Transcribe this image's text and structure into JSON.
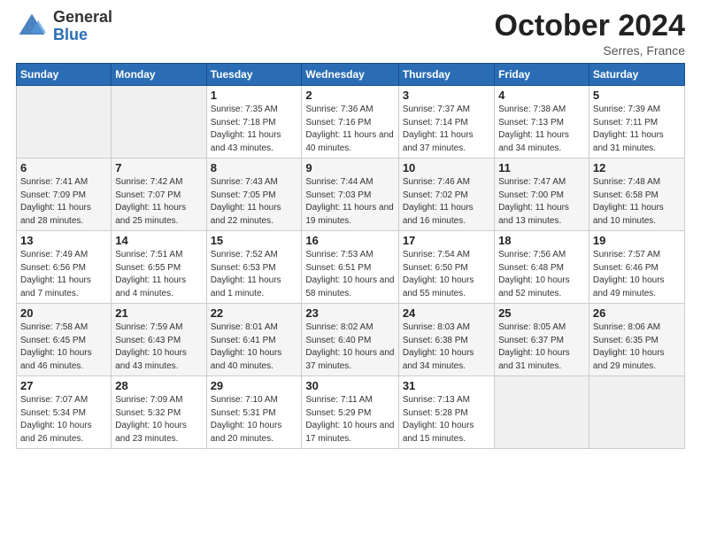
{
  "logo": {
    "general": "General",
    "blue": "Blue"
  },
  "header": {
    "month": "October 2024",
    "location": "Serres, France"
  },
  "days_of_week": [
    "Sunday",
    "Monday",
    "Tuesday",
    "Wednesday",
    "Thursday",
    "Friday",
    "Saturday"
  ],
  "weeks": [
    [
      {
        "day": "",
        "sunrise": "",
        "sunset": "",
        "daylight": ""
      },
      {
        "day": "",
        "sunrise": "",
        "sunset": "",
        "daylight": ""
      },
      {
        "day": "1",
        "sunrise": "Sunrise: 7:35 AM",
        "sunset": "Sunset: 7:18 PM",
        "daylight": "Daylight: 11 hours and 43 minutes."
      },
      {
        "day": "2",
        "sunrise": "Sunrise: 7:36 AM",
        "sunset": "Sunset: 7:16 PM",
        "daylight": "Daylight: 11 hours and 40 minutes."
      },
      {
        "day": "3",
        "sunrise": "Sunrise: 7:37 AM",
        "sunset": "Sunset: 7:14 PM",
        "daylight": "Daylight: 11 hours and 37 minutes."
      },
      {
        "day": "4",
        "sunrise": "Sunrise: 7:38 AM",
        "sunset": "Sunset: 7:13 PM",
        "daylight": "Daylight: 11 hours and 34 minutes."
      },
      {
        "day": "5",
        "sunrise": "Sunrise: 7:39 AM",
        "sunset": "Sunset: 7:11 PM",
        "daylight": "Daylight: 11 hours and 31 minutes."
      }
    ],
    [
      {
        "day": "6",
        "sunrise": "Sunrise: 7:41 AM",
        "sunset": "Sunset: 7:09 PM",
        "daylight": "Daylight: 11 hours and 28 minutes."
      },
      {
        "day": "7",
        "sunrise": "Sunrise: 7:42 AM",
        "sunset": "Sunset: 7:07 PM",
        "daylight": "Daylight: 11 hours and 25 minutes."
      },
      {
        "day": "8",
        "sunrise": "Sunrise: 7:43 AM",
        "sunset": "Sunset: 7:05 PM",
        "daylight": "Daylight: 11 hours and 22 minutes."
      },
      {
        "day": "9",
        "sunrise": "Sunrise: 7:44 AM",
        "sunset": "Sunset: 7:03 PM",
        "daylight": "Daylight: 11 hours and 19 minutes."
      },
      {
        "day": "10",
        "sunrise": "Sunrise: 7:46 AM",
        "sunset": "Sunset: 7:02 PM",
        "daylight": "Daylight: 11 hours and 16 minutes."
      },
      {
        "day": "11",
        "sunrise": "Sunrise: 7:47 AM",
        "sunset": "Sunset: 7:00 PM",
        "daylight": "Daylight: 11 hours and 13 minutes."
      },
      {
        "day": "12",
        "sunrise": "Sunrise: 7:48 AM",
        "sunset": "Sunset: 6:58 PM",
        "daylight": "Daylight: 11 hours and 10 minutes."
      }
    ],
    [
      {
        "day": "13",
        "sunrise": "Sunrise: 7:49 AM",
        "sunset": "Sunset: 6:56 PM",
        "daylight": "Daylight: 11 hours and 7 minutes."
      },
      {
        "day": "14",
        "sunrise": "Sunrise: 7:51 AM",
        "sunset": "Sunset: 6:55 PM",
        "daylight": "Daylight: 11 hours and 4 minutes."
      },
      {
        "day": "15",
        "sunrise": "Sunrise: 7:52 AM",
        "sunset": "Sunset: 6:53 PM",
        "daylight": "Daylight: 11 hours and 1 minute."
      },
      {
        "day": "16",
        "sunrise": "Sunrise: 7:53 AM",
        "sunset": "Sunset: 6:51 PM",
        "daylight": "Daylight: 10 hours and 58 minutes."
      },
      {
        "day": "17",
        "sunrise": "Sunrise: 7:54 AM",
        "sunset": "Sunset: 6:50 PM",
        "daylight": "Daylight: 10 hours and 55 minutes."
      },
      {
        "day": "18",
        "sunrise": "Sunrise: 7:56 AM",
        "sunset": "Sunset: 6:48 PM",
        "daylight": "Daylight: 10 hours and 52 minutes."
      },
      {
        "day": "19",
        "sunrise": "Sunrise: 7:57 AM",
        "sunset": "Sunset: 6:46 PM",
        "daylight": "Daylight: 10 hours and 49 minutes."
      }
    ],
    [
      {
        "day": "20",
        "sunrise": "Sunrise: 7:58 AM",
        "sunset": "Sunset: 6:45 PM",
        "daylight": "Daylight: 10 hours and 46 minutes."
      },
      {
        "day": "21",
        "sunrise": "Sunrise: 7:59 AM",
        "sunset": "Sunset: 6:43 PM",
        "daylight": "Daylight: 10 hours and 43 minutes."
      },
      {
        "day": "22",
        "sunrise": "Sunrise: 8:01 AM",
        "sunset": "Sunset: 6:41 PM",
        "daylight": "Daylight: 10 hours and 40 minutes."
      },
      {
        "day": "23",
        "sunrise": "Sunrise: 8:02 AM",
        "sunset": "Sunset: 6:40 PM",
        "daylight": "Daylight: 10 hours and 37 minutes."
      },
      {
        "day": "24",
        "sunrise": "Sunrise: 8:03 AM",
        "sunset": "Sunset: 6:38 PM",
        "daylight": "Daylight: 10 hours and 34 minutes."
      },
      {
        "day": "25",
        "sunrise": "Sunrise: 8:05 AM",
        "sunset": "Sunset: 6:37 PM",
        "daylight": "Daylight: 10 hours and 31 minutes."
      },
      {
        "day": "26",
        "sunrise": "Sunrise: 8:06 AM",
        "sunset": "Sunset: 6:35 PM",
        "daylight": "Daylight: 10 hours and 29 minutes."
      }
    ],
    [
      {
        "day": "27",
        "sunrise": "Sunrise: 7:07 AM",
        "sunset": "Sunset: 5:34 PM",
        "daylight": "Daylight: 10 hours and 26 minutes."
      },
      {
        "day": "28",
        "sunrise": "Sunrise: 7:09 AM",
        "sunset": "Sunset: 5:32 PM",
        "daylight": "Daylight: 10 hours and 23 minutes."
      },
      {
        "day": "29",
        "sunrise": "Sunrise: 7:10 AM",
        "sunset": "Sunset: 5:31 PM",
        "daylight": "Daylight: 10 hours and 20 minutes."
      },
      {
        "day": "30",
        "sunrise": "Sunrise: 7:11 AM",
        "sunset": "Sunset: 5:29 PM",
        "daylight": "Daylight: 10 hours and 17 minutes."
      },
      {
        "day": "31",
        "sunrise": "Sunrise: 7:13 AM",
        "sunset": "Sunset: 5:28 PM",
        "daylight": "Daylight: 10 hours and 15 minutes."
      },
      {
        "day": "",
        "sunrise": "",
        "sunset": "",
        "daylight": ""
      },
      {
        "day": "",
        "sunrise": "",
        "sunset": "",
        "daylight": ""
      }
    ]
  ]
}
